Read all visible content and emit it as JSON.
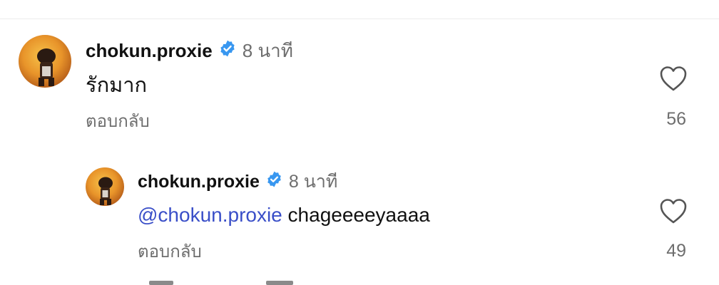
{
  "comments": [
    {
      "username": "chokun.proxie",
      "verified": true,
      "time": "8 นาที",
      "text": "รักมาก",
      "reply_label": "ตอบกลับ",
      "likes": "56"
    }
  ],
  "reply": {
    "username": "chokun.proxie",
    "verified": true,
    "time": "8 นาที",
    "mention": "@chokun.proxie",
    "text": " chageeeeyaaaa",
    "reply_label": "ตอบกลับ",
    "likes": "49"
  },
  "colors": {
    "mention": "#3a4fc8",
    "verified_badge": "#3897f0",
    "muted_text": "#6e6e6e"
  },
  "icons": {
    "like": "heart-outline-icon",
    "verified": "verified-badge-icon"
  }
}
